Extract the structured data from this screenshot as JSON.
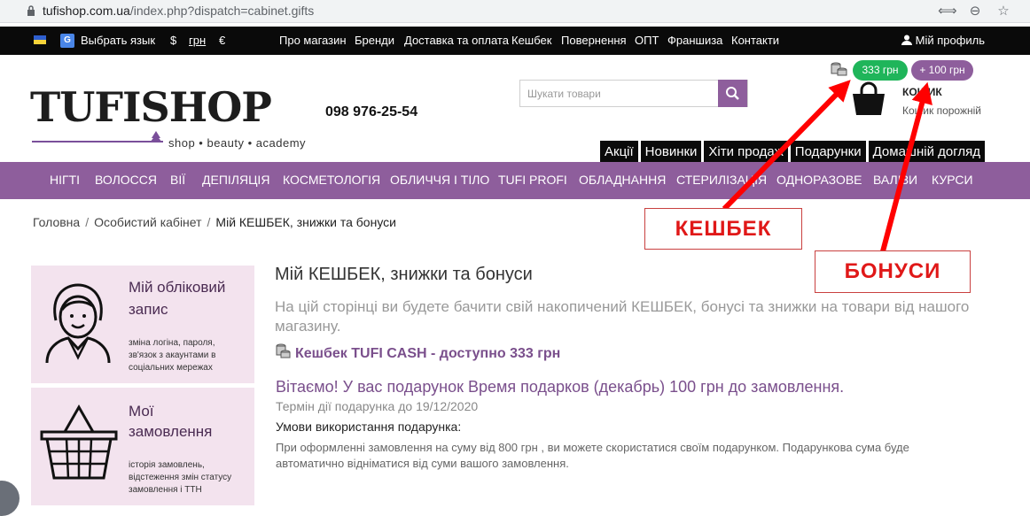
{
  "browser": {
    "url_host": "tufishop.com.ua",
    "url_path": "/index.php?dispatch=cabinet.gifts"
  },
  "topbar": {
    "language_label": "Выбрать язык",
    "currencies": [
      "$",
      "грн",
      "€"
    ],
    "links": [
      "Про магазин",
      "Бренди",
      "Доставка та оплата",
      "Кешбек",
      "Повернення",
      "ОПТ",
      "Франшиза",
      "Контакти"
    ],
    "profile": "Мій профиль"
  },
  "header": {
    "logo_text": "TUFISHOP",
    "logo_tagline": "shop • beauty • academy",
    "phone": "098 976-25-54",
    "search_placeholder": "Шукати товари",
    "cashback_amount": "333 грн",
    "bonus_amount": "+ 100 грн",
    "cart_title": "КОШИК",
    "cart_status": "Кошик порожній",
    "categories": [
      "Акції",
      "Новинки",
      "Хіти продаж",
      "Подарунки",
      "Домашній догляд"
    ]
  },
  "menu": [
    "НІГТІ",
    "ВОЛОССЯ",
    "ВІЇ",
    "ДЕПІЛЯЦІЯ",
    "КОСМЕТОЛОГІЯ",
    "ОБЛИЧЧЯ І ТІЛО",
    "TUFI PROFI",
    "ОБЛАДНАННЯ",
    "СТЕРИЛІЗАЦІЯ",
    "ОДНОРАЗОВЕ",
    "ВАЛІЗИ",
    "КУРСИ"
  ],
  "breadcrumb": [
    "Головна",
    "Особистий кабінет",
    "Мій КЕШБЕК, знижки та бонуси"
  ],
  "sidebar": {
    "account": {
      "title_1": "Мій обліковий",
      "title_2": "запис",
      "desc_1": "зміна логіна, пароля,",
      "desc_2": "зв'язок з акаунтами в",
      "desc_3": "соціальних мережах"
    },
    "orders": {
      "title_1": "Мої",
      "title_2": "замовлення",
      "desc_1": "історія замовлень,",
      "desc_2": "відстеження змін статусу",
      "desc_3": "замовлення і ТТН"
    }
  },
  "main": {
    "title": "Мій КЕШБЕК, знижки та бонуси",
    "intro": "На цій сторінці ви будете бачити свій накопичений КЕШБЕК, бонусі та знижки на товари від нашого магазину.",
    "cashback": "Кешбек TUFI CASH - доступно 333 грн",
    "gift": "Вітаємо! У вас подарунок Время подарков (декабрь) 100 грн до замовлення.",
    "term": "Термін дії подарунка до 19/12/2020",
    "conditions_title": "Умови використання подарунка:",
    "conditions_text": "При оформленні замовлення на суму від 800 грн , ви можете скористатися своїм подарунком. Подарункова сума буде автоматично відніматися від суми вашого замовлення."
  },
  "annotations": {
    "cashback_label": "КЕШБЕК",
    "bonus_label": "БОНУСИ"
  },
  "colors": {
    "brand_purple": "#8e5e9c",
    "cashback_green": "#1fb55a",
    "annotation_red": "#e01818",
    "card_pink": "#f3e3ee"
  }
}
